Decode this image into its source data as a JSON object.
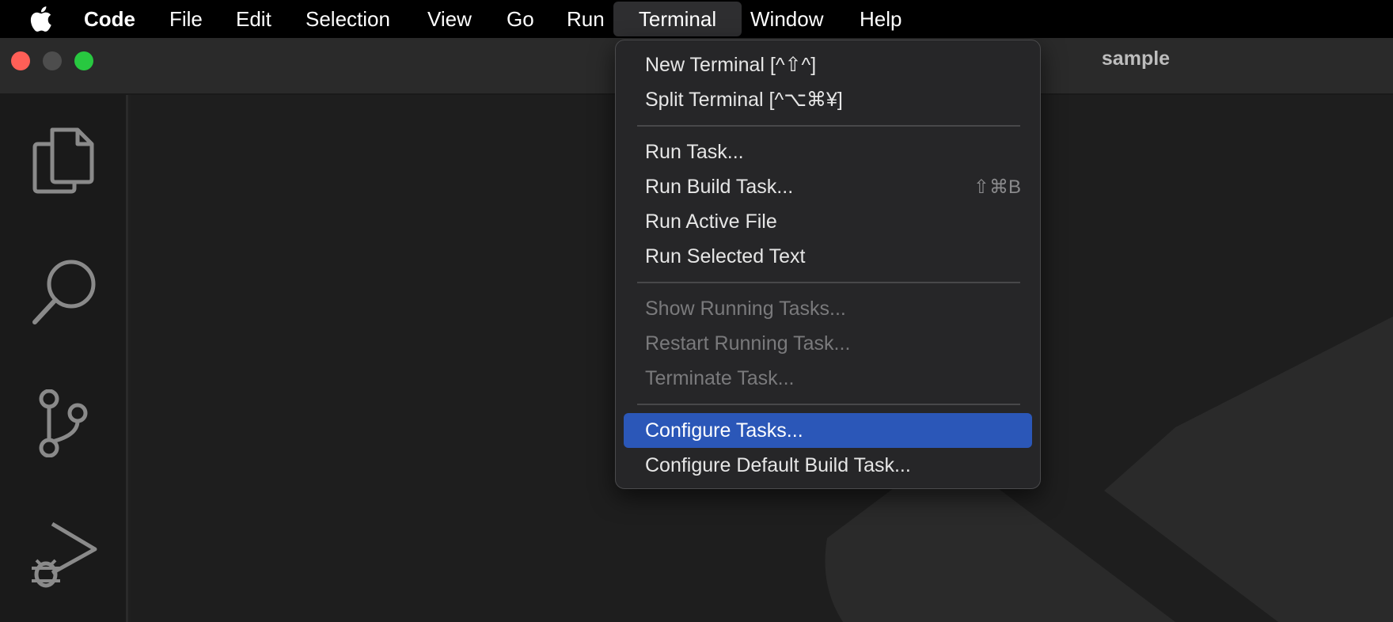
{
  "menubar": {
    "app_name": "Code",
    "items": [
      "File",
      "Edit",
      "Selection",
      "View",
      "Go",
      "Run",
      "Terminal",
      "Window",
      "Help"
    ],
    "active": "Terminal"
  },
  "window": {
    "title": "sample"
  },
  "activitybar": {
    "icons": [
      "files-icon",
      "search-icon",
      "source-control-icon",
      "run-debug-icon"
    ]
  },
  "terminal_menu": {
    "groups": [
      [
        {
          "label": "New Terminal [^⇧^]",
          "shortcut": "",
          "enabled": true
        },
        {
          "label": "Split Terminal [^⌥⌘¥]",
          "shortcut": "",
          "enabled": true
        }
      ],
      [
        {
          "label": "Run Task...",
          "shortcut": "",
          "enabled": true
        },
        {
          "label": "Run Build Task...",
          "shortcut": "⇧⌘B",
          "enabled": true
        },
        {
          "label": "Run Active File",
          "shortcut": "",
          "enabled": true
        },
        {
          "label": "Run Selected Text",
          "shortcut": "",
          "enabled": true
        }
      ],
      [
        {
          "label": "Show Running Tasks...",
          "shortcut": "",
          "enabled": false
        },
        {
          "label": "Restart Running Task...",
          "shortcut": "",
          "enabled": false
        },
        {
          "label": "Terminate Task...",
          "shortcut": "",
          "enabled": false
        }
      ],
      [
        {
          "label": "Configure Tasks...",
          "shortcut": "",
          "enabled": true,
          "highlighted": true
        },
        {
          "label": "Configure Default Build Task...",
          "shortcut": "",
          "enabled": true
        }
      ]
    ]
  },
  "colors": {
    "menubar_bg": "#000000",
    "menu_bg": "#262628",
    "highlight": "#2b57b8",
    "disabled_text": "#7a7a7c"
  }
}
